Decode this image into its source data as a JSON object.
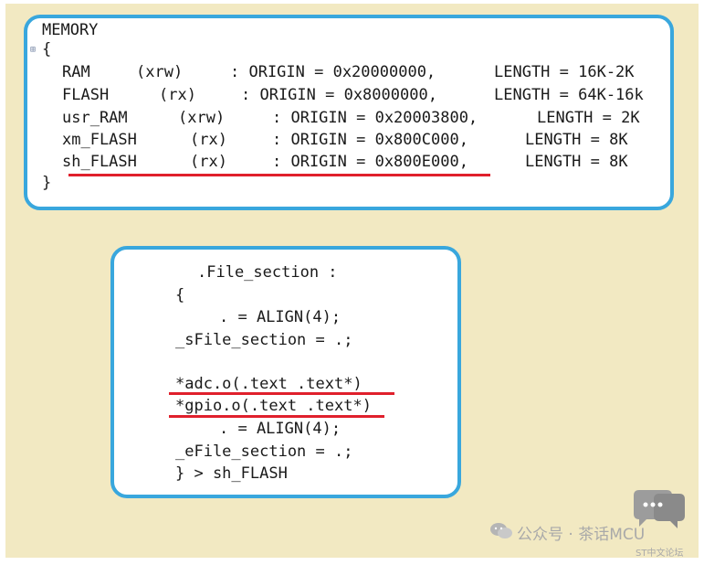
{
  "memory": {
    "header": "MEMORY",
    "open_brace": "{",
    "close_brace": "}",
    "rows": [
      {
        "name": "RAM",
        "attr": "(xrw)",
        "origin": ": ORIGIN = 0x20000000,",
        "length": "LENGTH = 16K-2K"
      },
      {
        "name": "FLASH",
        "attr": "(rx)",
        "origin": ": ORIGIN = 0x8000000,",
        "length": "LENGTH = 64K-16k"
      },
      {
        "name": "usr_RAM",
        "attr": "(xrw)",
        "origin": ": ORIGIN = 0x20003800,",
        "length": "LENGTH = 2K"
      },
      {
        "name": "xm_FLASH",
        "attr": "(rx)",
        "origin": ": ORIGIN = 0x800C000,",
        "length": "LENGTH = 8K"
      },
      {
        "name": "sh_FLASH",
        "attr": "(rx)",
        "origin": ": ORIGIN = 0x800E000,",
        "length": "LENGTH = 8K"
      }
    ]
  },
  "section": {
    "lines": [
      ".File_section :",
      "{",
      ". = ALIGN(4);",
      "_sFile_section = .;",
      "*adc.o(.text .text*)",
      "*gpio.o(.text .text*)",
      ". = ALIGN(4);",
      "_eFile_section = .;",
      "} > sh_FLASH"
    ]
  },
  "watermark": {
    "channel": "公众号 · 茶话MCU",
    "forum": "ST中文论坛"
  },
  "colors": {
    "background": "#f2e9c2",
    "panel_border": "#39a7dd",
    "highlight": "#e0202c"
  }
}
